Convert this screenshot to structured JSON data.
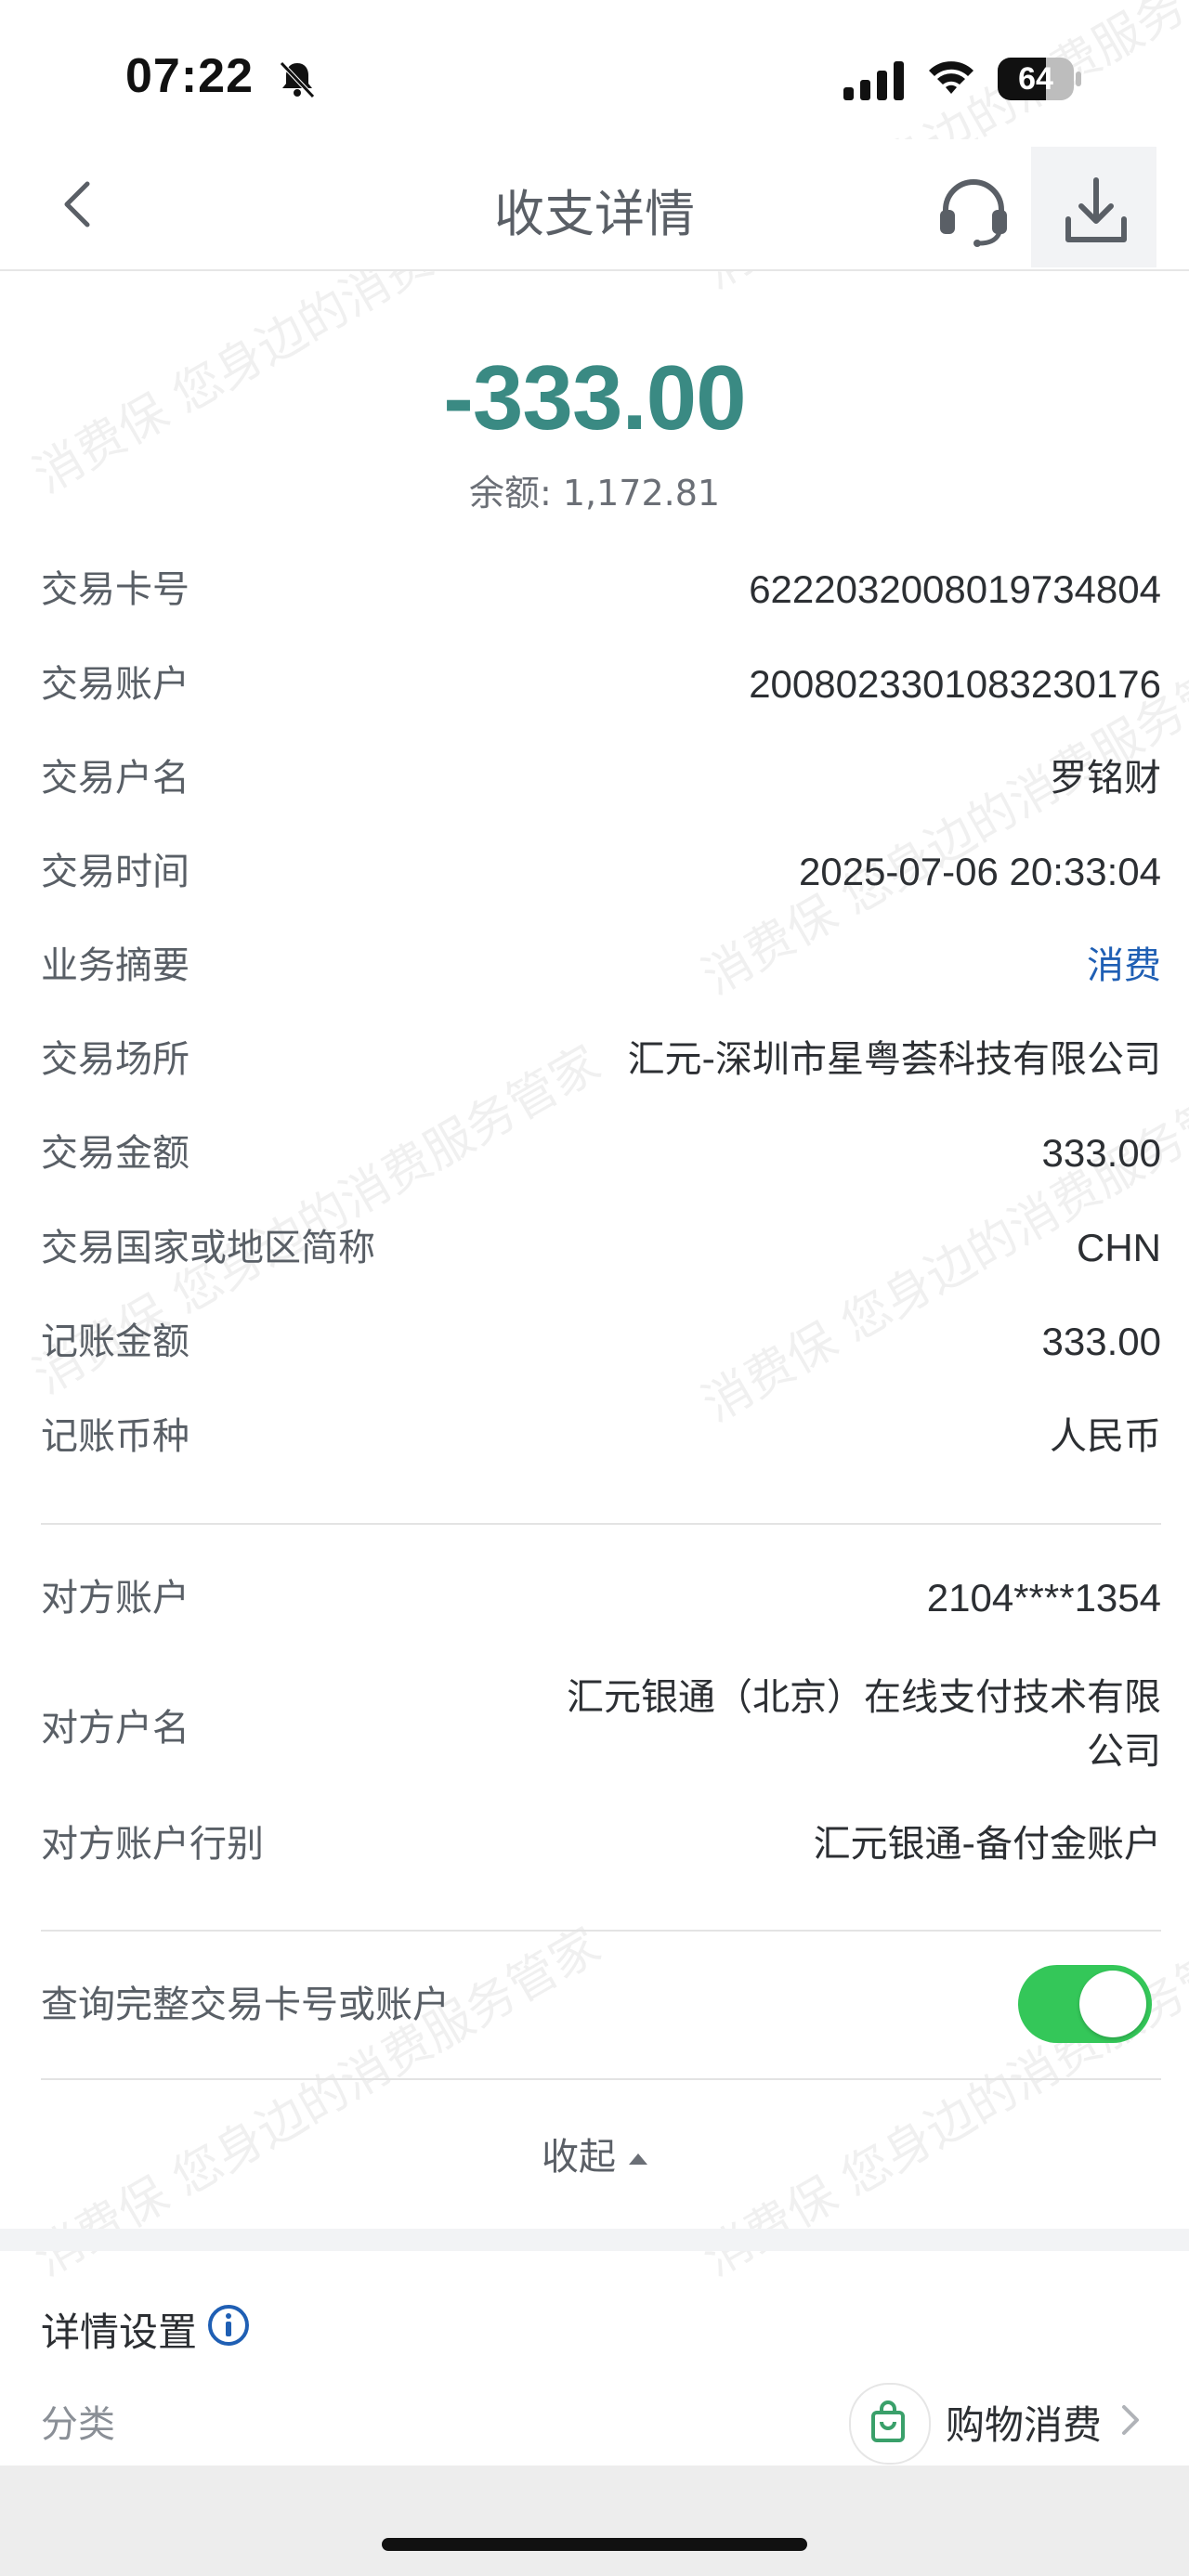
{
  "status_bar": {
    "time": "07:22",
    "battery": "64",
    "battery_level": 0.64
  },
  "nav": {
    "title": "收支详情"
  },
  "summary": {
    "amount": "-333.00",
    "balance_label": "余额:",
    "balance_value": "1,172.81"
  },
  "details": [
    {
      "label": "交易卡号",
      "value": "6222032008019734804"
    },
    {
      "label": "交易账户",
      "value": "2008023301083230176"
    },
    {
      "label": "交易户名",
      "value": "罗铭财"
    },
    {
      "label": "交易时间",
      "value": "2025-07-06 20:33:04"
    },
    {
      "label": "业务摘要",
      "value": "消费"
    },
    {
      "label": "交易场所",
      "value": "汇元-深圳市星粤荟科技有限公司"
    },
    {
      "label": "交易金额",
      "value": "333.00"
    },
    {
      "label": "交易国家或地区简称",
      "value": "CHN"
    },
    {
      "label": "记账金额",
      "value": "333.00"
    },
    {
      "label": "记账币种",
      "value": "人民币"
    }
  ],
  "counterparty": [
    {
      "label": "对方账户",
      "value": "2104****1354"
    },
    {
      "label": "对方户名",
      "value_line1": "汇元银通（北京）在线支付技术有限",
      "value_line2": "公司"
    },
    {
      "label": "对方账户行别",
      "value": "汇元银通-备付金账户"
    }
  ],
  "toggle": {
    "label": "查询完整交易卡号或账户",
    "on": true
  },
  "collapse_label": "收起",
  "settings": {
    "title": "详情设置",
    "category_label": "分类",
    "category_value": "购物消费"
  },
  "watermark": {
    "text": "消费保 您身边的消费服务管家"
  },
  "colors": {
    "amount": "#3a8a83",
    "link": "#1f5fb4",
    "toggle_on": "#34c759"
  }
}
